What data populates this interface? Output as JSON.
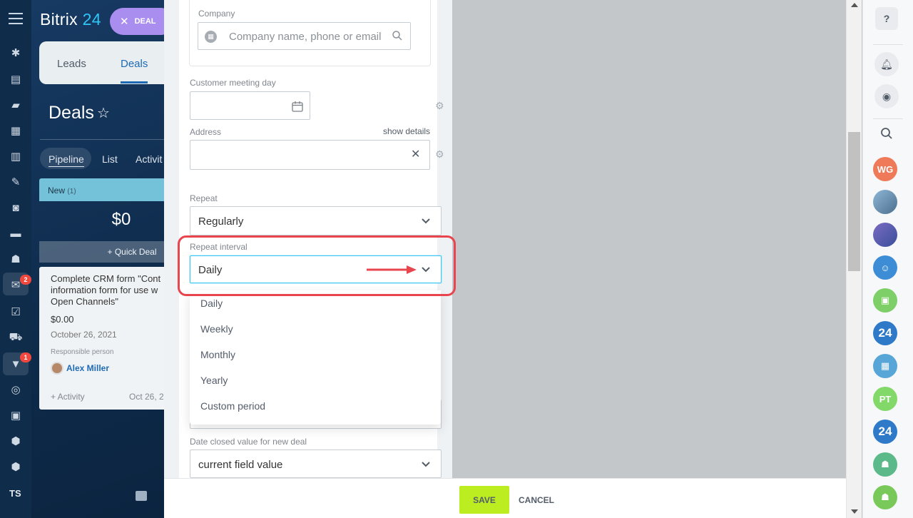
{
  "app": {
    "logo_main": "Bitrix",
    "logo_num": "24",
    "deal_chip": "DEAL"
  },
  "rail": {
    "badges": [
      "2",
      "1"
    ],
    "user_initials": "TS"
  },
  "crm": {
    "tabs": [
      "Leads",
      "Deals"
    ],
    "title": "Deals",
    "subtabs": [
      "Pipeline",
      "List",
      "Activit"
    ],
    "column": {
      "name": "New",
      "count": "(1)",
      "sum": "$0"
    },
    "quick_deal": "+ Quick Deal",
    "card": {
      "title": "Complete CRM form \"Cont information form for use w Open Channels\"",
      "amount": "$0.00",
      "date": "October 26, 2021",
      "responsible_label": "Responsible person",
      "responsible_name": "Alex Miller",
      "activity": "+ Activity",
      "activity_date": "Oct 26, 2"
    }
  },
  "form": {
    "company_label": "Company",
    "company_placeholder": "Company name, phone or email",
    "meeting_label": "Customer meeting day",
    "address_label": "Address",
    "show_details": "show details",
    "repeat_label": "Repeat",
    "repeat_value": "Regularly",
    "interval_label": "Repeat interval",
    "interval_value": "Daily",
    "interval_options": [
      "Daily",
      "Weekly",
      "Monthly",
      "Yearly",
      "Custom period"
    ],
    "date_closed_label": "Date closed value for new deal",
    "date_closed_value": "current field value"
  },
  "footer": {
    "save": "SAVE",
    "cancel": "CANCEL"
  },
  "right_sidebar": {
    "help": "?",
    "avatars": [
      {
        "initials": "WG",
        "color": "#ee7a5a"
      },
      {
        "initials": "PT",
        "color": "#82d96a"
      }
    ]
  },
  "colors": {
    "accent_blue": "#1f6ab5",
    "save_green": "#bbed21",
    "highlight_red": "#e8454f",
    "focus_cyan": "#3bc8f5"
  }
}
